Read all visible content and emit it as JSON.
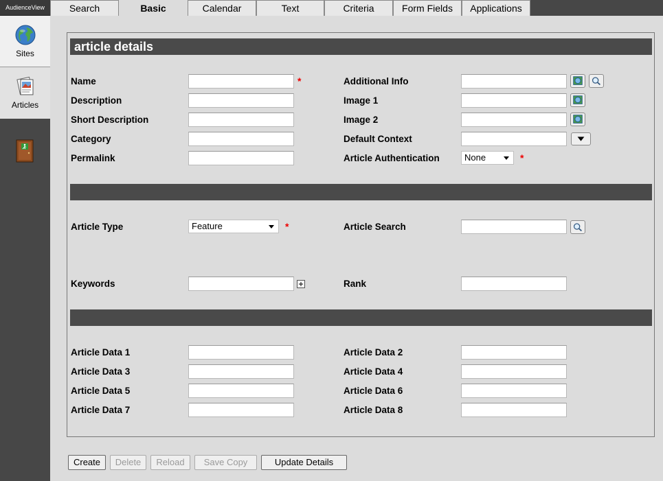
{
  "app": {
    "logo": "AudienceView"
  },
  "sidebar": {
    "items": [
      {
        "label": "Sites",
        "icon": "globe-icon"
      },
      {
        "label": "Articles",
        "icon": "articles-icon"
      }
    ],
    "exit_icon": "exit-door-icon"
  },
  "tabs": [
    "Search",
    "Basic",
    "Calendar",
    "Text",
    "Criteria",
    "Form Fields",
    "Applications"
  ],
  "active_tab": "Basic",
  "section_title": "article details",
  "fields": {
    "name": {
      "label": "Name",
      "value": ""
    },
    "description": {
      "label": "Description",
      "value": ""
    },
    "short_description": {
      "label": "Short Description",
      "value": ""
    },
    "category": {
      "label": "Category",
      "value": ""
    },
    "permalink": {
      "label": "Permalink",
      "value": ""
    },
    "additional_info": {
      "label": "Additional Info",
      "value": ""
    },
    "image1": {
      "label": "Image 1",
      "value": ""
    },
    "image2": {
      "label": "Image 2",
      "value": ""
    },
    "default_context": {
      "label": "Default Context",
      "value": ""
    },
    "article_authentication": {
      "label": "Article Authentication",
      "value": "None"
    },
    "article_type": {
      "label": "Article Type",
      "value": "Feature"
    },
    "article_search": {
      "label": "Article Search",
      "value": ""
    },
    "keywords": {
      "label": "Keywords",
      "value": ""
    },
    "rank": {
      "label": "Rank",
      "value": ""
    },
    "data1": {
      "label": "Article Data 1",
      "value": ""
    },
    "data2": {
      "label": "Article Data 2",
      "value": ""
    },
    "data3": {
      "label": "Article Data 3",
      "value": ""
    },
    "data4": {
      "label": "Article Data 4",
      "value": ""
    },
    "data5": {
      "label": "Article Data 5",
      "value": ""
    },
    "data6": {
      "label": "Article Data 6",
      "value": ""
    },
    "data7": {
      "label": "Article Data 7",
      "value": ""
    },
    "data8": {
      "label": "Article Data 8",
      "value": ""
    }
  },
  "required_mark": "*",
  "buttons": {
    "create": "Create",
    "delete": "Delete",
    "reload": "Reload",
    "save_copy": "Save Copy",
    "update_details": "Update Details"
  },
  "colors": {
    "section_bar": "#4a4a4a",
    "required": "#e00000",
    "sidebar": "#474747"
  }
}
